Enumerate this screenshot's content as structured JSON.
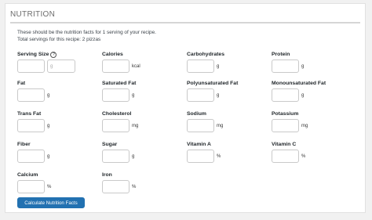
{
  "section": {
    "title": "NUTRITION"
  },
  "intro": {
    "line1": "These should be the nutrition facts for 1 serving of your recipe.",
    "line2": "Total servings for this recipe: 2 pizzas"
  },
  "serving_size": {
    "label": "Serving Size",
    "amount": "",
    "unit_placeholder": "g"
  },
  "fields": {
    "calories": {
      "label": "Calories",
      "unit": "kcal"
    },
    "carbohydrates": {
      "label": "Carbohydrates",
      "unit": "g"
    },
    "protein": {
      "label": "Protein",
      "unit": "g"
    },
    "fat": {
      "label": "Fat",
      "unit": "g"
    },
    "saturated_fat": {
      "label": "Saturated Fat",
      "unit": "g"
    },
    "polyunsaturated_fat": {
      "label": "Polyunsaturated Fat",
      "unit": "g"
    },
    "monounsaturated_fat": {
      "label": "Monounsaturated Fat",
      "unit": "g"
    },
    "trans_fat": {
      "label": "Trans Fat",
      "unit": "g"
    },
    "cholesterol": {
      "label": "Cholesterol",
      "unit": "mg"
    },
    "sodium": {
      "label": "Sodium",
      "unit": "mg"
    },
    "potassium": {
      "label": "Potassium",
      "unit": "mg"
    },
    "fiber": {
      "label": "Fiber",
      "unit": "g"
    },
    "sugar": {
      "label": "Sugar",
      "unit": "g"
    },
    "vitamin_a": {
      "label": "Vitamin A",
      "unit": "%"
    },
    "vitamin_c": {
      "label": "Vitamin C",
      "unit": "%"
    },
    "calcium": {
      "label": "Calcium",
      "unit": "%"
    },
    "iron": {
      "label": "Iron",
      "unit": "%"
    }
  },
  "button": {
    "label": "Calculate Nutrition Facts"
  },
  "colors": {
    "accent": "#2271b1",
    "border": "#c9c9c9",
    "rule": "#d6d6d6"
  }
}
